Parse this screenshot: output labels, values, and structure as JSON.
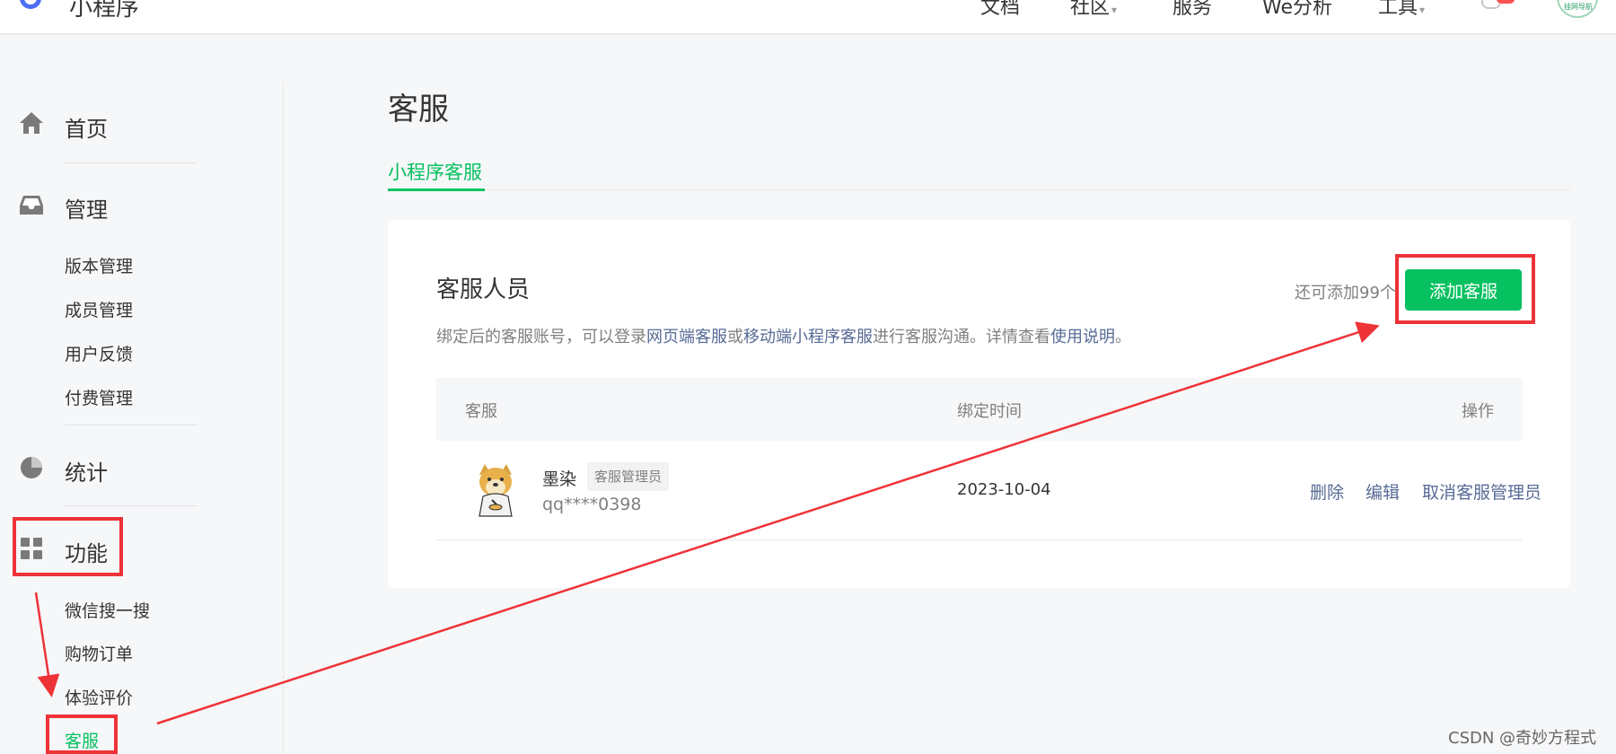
{
  "topbar": {
    "brand": "小程序",
    "nav": [
      {
        "label": "文档"
      },
      {
        "label": "社区"
      },
      {
        "label": "服务"
      },
      {
        "label": "We分析"
      },
      {
        "label": "工具"
      }
    ],
    "dropdown_caret": "▾",
    "avatar_text": "挂网导航"
  },
  "sidebar": {
    "home": "首页",
    "manage": "管理",
    "manage_items": [
      "版本管理",
      "成员管理",
      "用户反馈",
      "付费管理"
    ],
    "stats": "统计",
    "features": "功能",
    "feature_items": [
      "微信搜一搜",
      "购物订单",
      "体验评价",
      "客服"
    ]
  },
  "main": {
    "title": "客服",
    "tab": "小程序客服",
    "card": {
      "title": "客服人员",
      "desc_parts": [
        "绑定后的客服账号，可以登录",
        "网页端客服",
        "或",
        "移动端小程序客服",
        "进行客服沟通。详情查看",
        "使用说明",
        "。"
      ],
      "remaining": "还可添加99个",
      "add_button": "添加客服",
      "columns": [
        "客服",
        "绑定时间",
        "操作"
      ],
      "rows": [
        {
          "name": "墨染",
          "role": "客服管理员",
          "account": "qq****0398",
          "bind_time": "2023-10-04",
          "actions": [
            "删除",
            "编辑",
            "取消客服管理员"
          ]
        }
      ]
    }
  },
  "watermark": "CSDN @奇妙方程式",
  "colors": {
    "brand_green": "#07c160",
    "link_blue": "#576b95",
    "annotation_red": "#ee3338"
  }
}
